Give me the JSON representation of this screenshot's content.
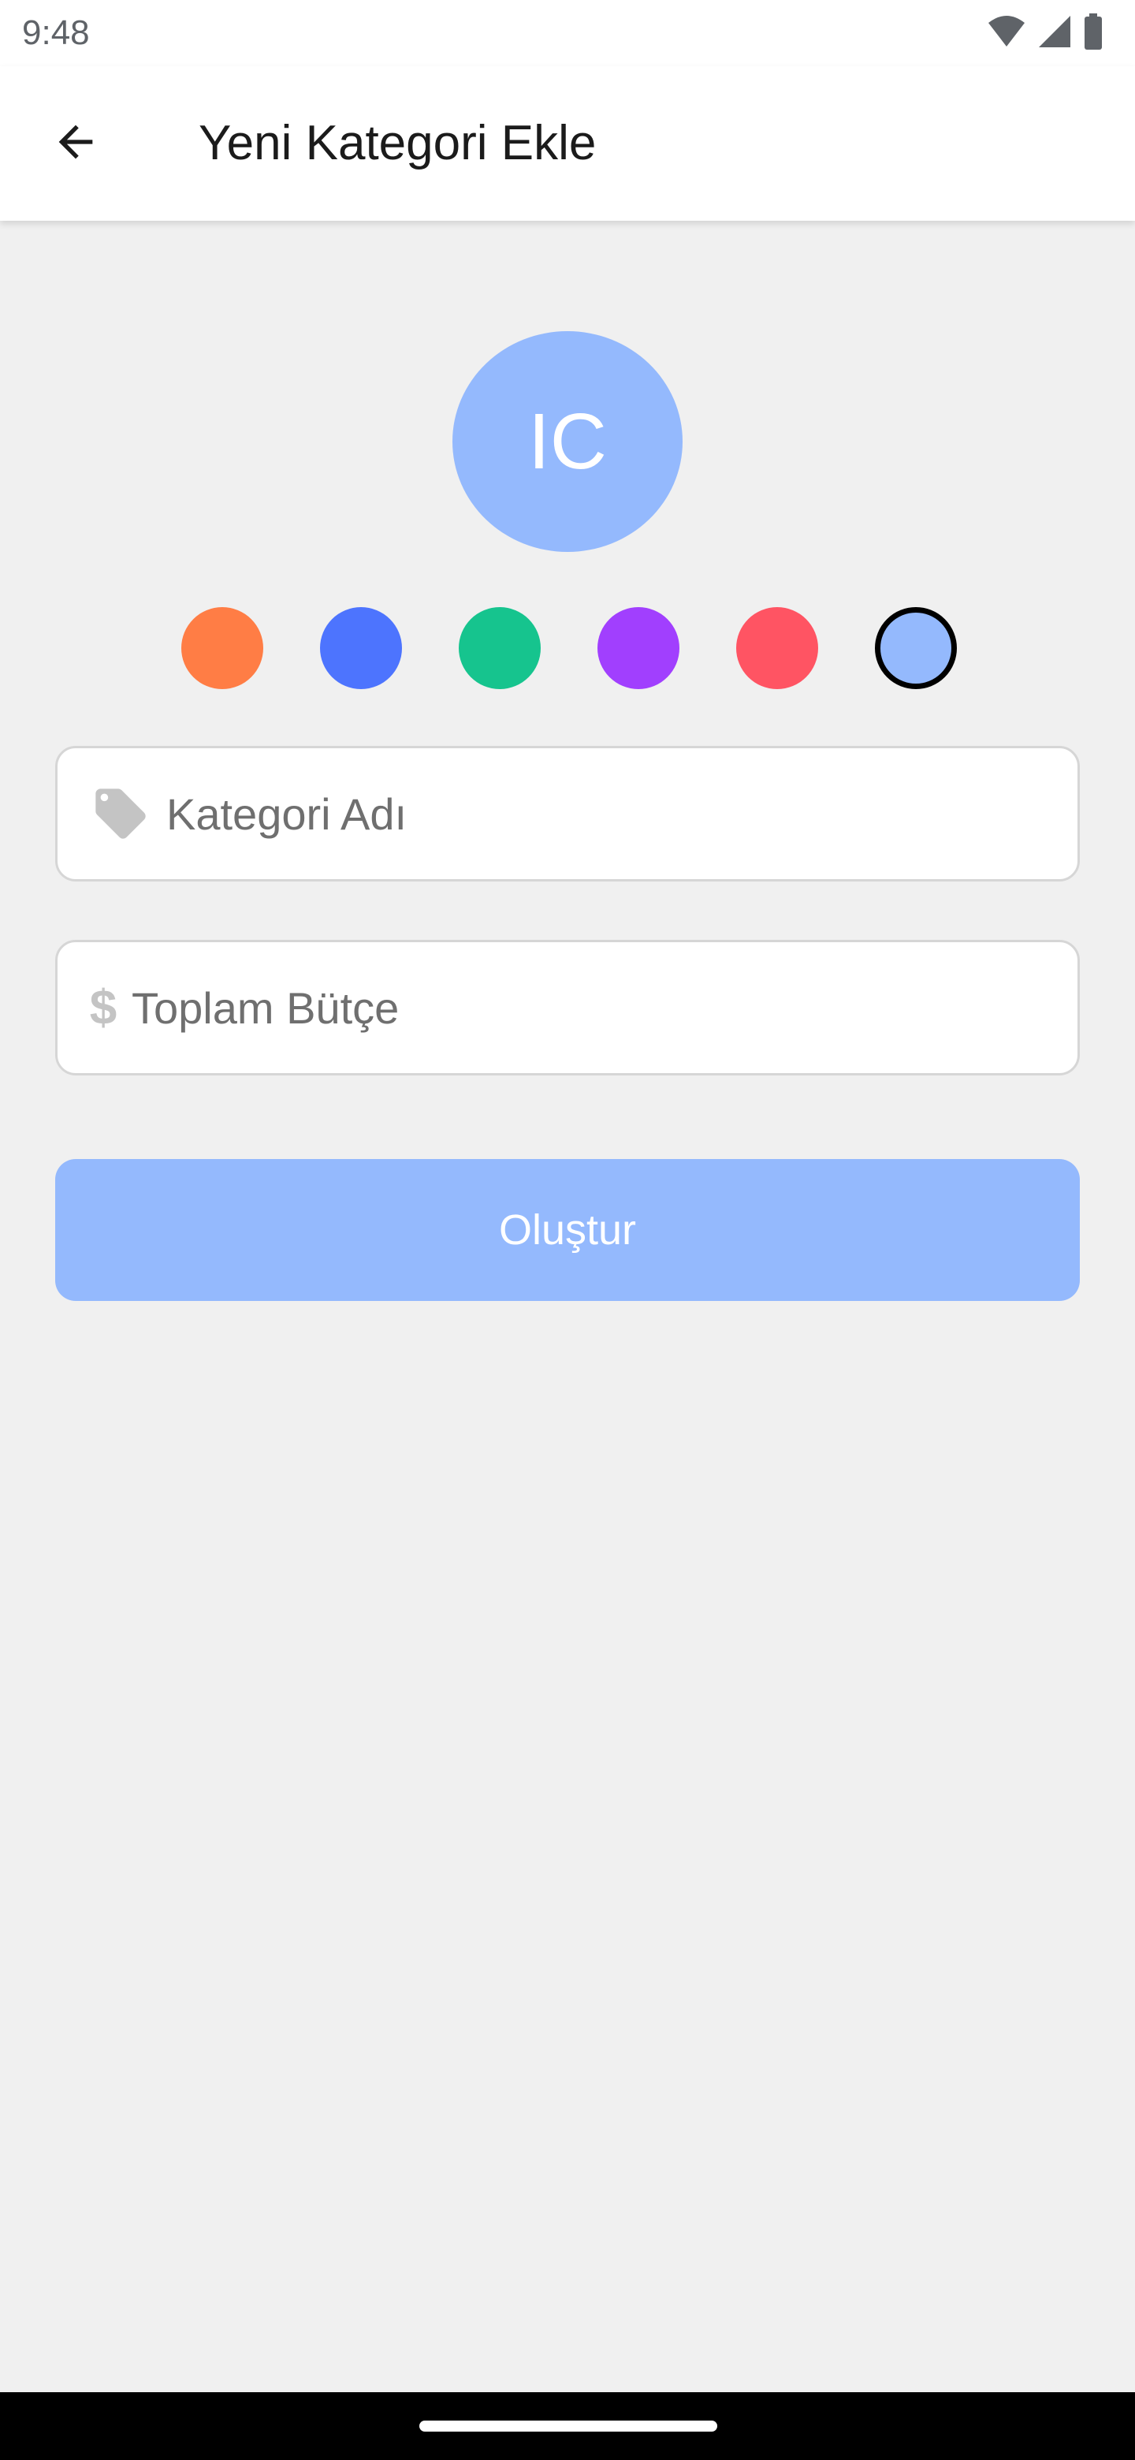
{
  "status_bar": {
    "time": "9:48"
  },
  "header": {
    "title": "Yeni Kategori Ekle",
    "back_icon": "arrow-back-icon"
  },
  "avatar": {
    "initials": "IC",
    "color": "#94b9fd"
  },
  "color_options": [
    {
      "name": "orange",
      "color": "#ff7d45",
      "selected": false
    },
    {
      "name": "blue",
      "color": "#4d74fe",
      "selected": false
    },
    {
      "name": "green",
      "color": "#16c48e",
      "selected": false
    },
    {
      "name": "purple",
      "color": "#a13ffe",
      "selected": false
    },
    {
      "name": "red",
      "color": "#ff5463",
      "selected": false
    },
    {
      "name": "light-blue",
      "color": "#94b9fd",
      "selected": true
    }
  ],
  "form": {
    "category_name": {
      "placeholder": "Kategori Adı",
      "value": "",
      "icon": "tag-icon"
    },
    "total_budget": {
      "placeholder": "Toplam Bütçe",
      "value": "",
      "icon_glyph": "$"
    },
    "submit_label": "Oluştur",
    "submit_color": "#94b9fd"
  }
}
